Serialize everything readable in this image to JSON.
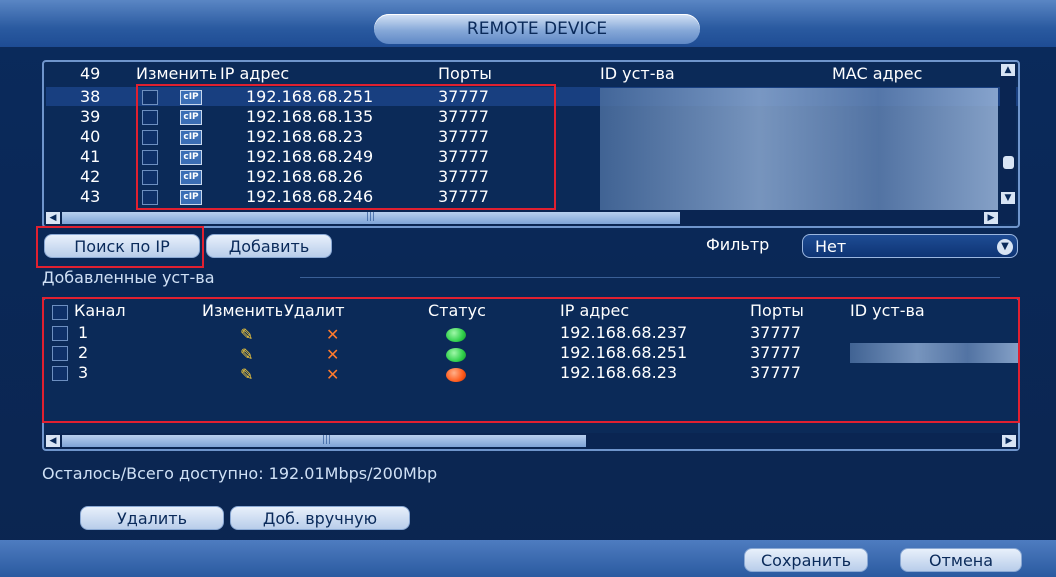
{
  "window": {
    "title": "REMOTE DEVICE"
  },
  "search_table": {
    "headers": {
      "num": "49",
      "change": "Изменить",
      "ip": "IP адрес",
      "ports": "Порты",
      "id": "ID уст-ва",
      "mac": "MAC адрес"
    },
    "rows": [
      {
        "num": "38",
        "ip": "192.168.68.251",
        "port": "37777",
        "selected": true
      },
      {
        "num": "39",
        "ip": "192.168.68.135",
        "port": "37777"
      },
      {
        "num": "40",
        "ip": "192.168.68.23",
        "port": "37777"
      },
      {
        "num": "41",
        "ip": "192.168.68.249",
        "port": "37777"
      },
      {
        "num": "42",
        "ip": "192.168.68.26",
        "port": "37777"
      },
      {
        "num": "43",
        "ip": "192.168.68.246",
        "port": "37777"
      }
    ],
    "ip_icon_label": "cIP"
  },
  "buttons": {
    "search_ip": "Поиск по IP",
    "add": "Добавить",
    "delete": "Удалить",
    "add_manual": "Доб. вручную",
    "save": "Сохранить",
    "cancel": "Отмена"
  },
  "filter": {
    "label": "Фильтр",
    "value": "Нет"
  },
  "added_section": {
    "label": "Добавленные уст-ва"
  },
  "added_table": {
    "headers": {
      "channel": "Канал",
      "change": "Изменить",
      "delete": "Удалит",
      "status": "Статус",
      "ip": "IP адрес",
      "ports": "Порты",
      "id": "ID уст-ва"
    },
    "rows": [
      {
        "channel": "1",
        "ip": "192.168.68.237",
        "port": "37777",
        "status_color": "#2fd04a"
      },
      {
        "channel": "2",
        "ip": "192.168.68.251",
        "port": "37777",
        "status_color": "#2fd04a"
      },
      {
        "channel": "3",
        "ip": "192.168.68.23",
        "port": "37777",
        "status_color": "#ff5a1a"
      }
    ]
  },
  "bandwidth": {
    "text": "Осталось/Всего доступно: 192.01Mbps/200Mbp"
  },
  "colors": {
    "accent": "#2a5aa0",
    "highlight_box": "#e02030",
    "status_online": "#2fd04a",
    "status_offline": "#ff5a1a"
  }
}
